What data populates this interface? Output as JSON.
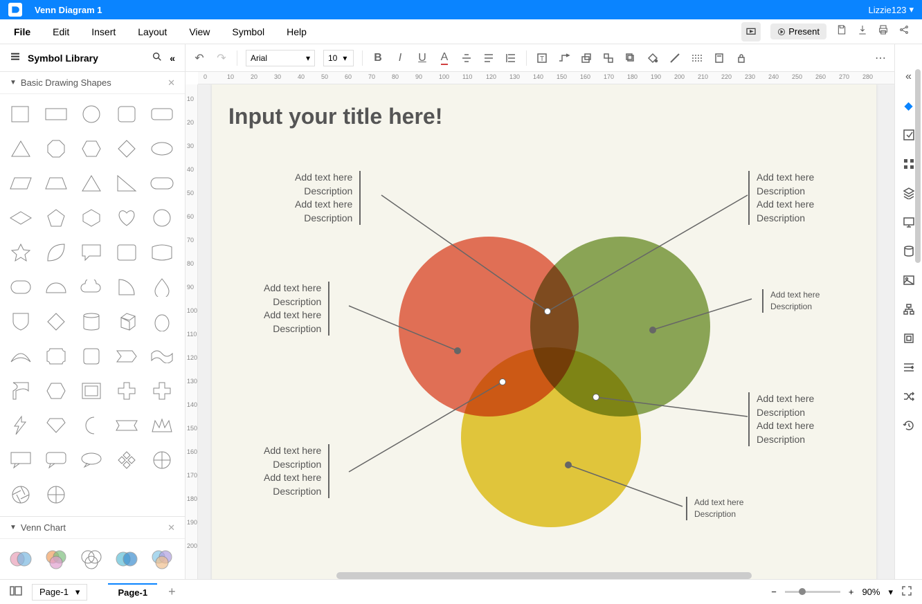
{
  "titlebar": {
    "doc_title": "Venn Diagram 1",
    "user": "Lizzie123"
  },
  "menus": [
    "File",
    "Edit",
    "Insert",
    "Layout",
    "View",
    "Symbol",
    "Help"
  ],
  "present_label": "Present",
  "sidebar": {
    "title": "Symbol Library",
    "section1": "Basic Drawing Shapes",
    "section2": "Venn Chart"
  },
  "toolbar": {
    "font": "Arial",
    "font_size": "10"
  },
  "canvas": {
    "title": "Input your title here!",
    "callouts": {
      "top_left": [
        "Add text here",
        "Description",
        "Add text here",
        "Description"
      ],
      "mid_left": [
        "Add text here",
        "Description",
        "Add text here",
        "Description"
      ],
      "bot_left": [
        "Add text here",
        "Description",
        "Add text here",
        "Description"
      ],
      "top_right": [
        "Add text here",
        "Description",
        "Add text here",
        "Description"
      ],
      "mid_right_small": [
        "Add text here",
        "Description"
      ],
      "bot_right": [
        "Add text here",
        "Description",
        "Add text here",
        "Description"
      ],
      "bot_right_small": [
        "Add text here",
        "Description"
      ]
    }
  },
  "bottom": {
    "page_dropdown": "Page-1",
    "page_tab": "Page-1",
    "zoom": "90%"
  }
}
